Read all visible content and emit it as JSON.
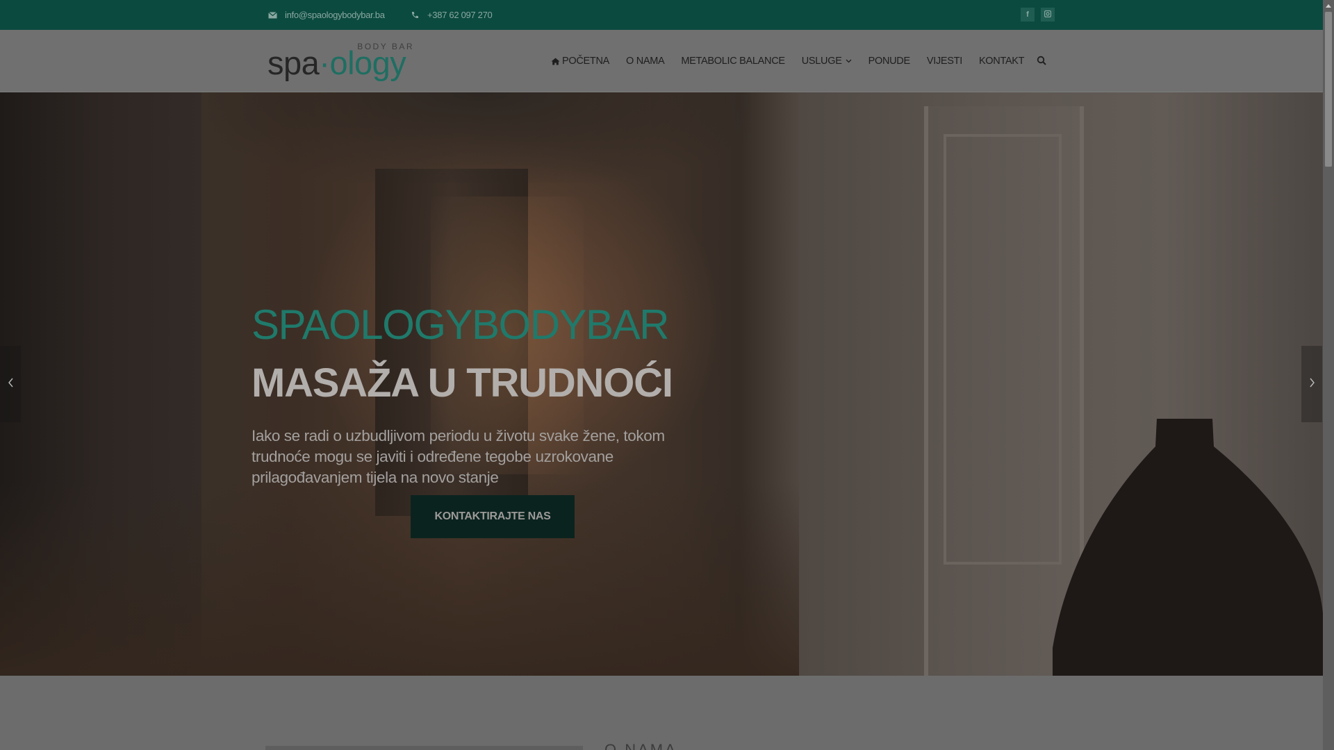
{
  "topbar": {
    "email": "info@spaologybodybar.ba",
    "phone": "+387 62 097 270",
    "social": [
      {
        "name": "facebook-icon",
        "glyph": "f"
      },
      {
        "name": "instagram-icon",
        "glyph": "◘"
      }
    ]
  },
  "logo": {
    "sub": "BODY BAR",
    "main_a": "spa",
    "main_dot": "·",
    "main_b": "ology"
  },
  "nav": {
    "items": [
      {
        "label": "POČETNA",
        "icon": "home-icon"
      },
      {
        "label": "O NAMA"
      },
      {
        "label": "METABOLIC BALANCE"
      },
      {
        "label": "USLUGE",
        "icon": "chevron-down-icon"
      },
      {
        "label": "PONUDE"
      },
      {
        "label": "VIJESTI"
      },
      {
        "label": "KONTAKT"
      }
    ],
    "search_icon": "search-icon"
  },
  "hero": {
    "tagline": "SPAOLOGYBODYBAR",
    "title": "MASAŽA U TRUDNOĆI",
    "text": "Iako se radi o uzbudljivom periodu u životu svake žene, tokom trudnoće mogu se javiti i određene tegobe uzrokovane prilagođavanjem tijela na novo stanje",
    "button": "KONTAKTIRAJTE NAS"
  },
  "below": {
    "heading_peek": "O NAMA"
  },
  "colors": {
    "topbar": "#0b4a3f",
    "accent": "#1f7a6b",
    "button_bg": "#0b231f"
  }
}
